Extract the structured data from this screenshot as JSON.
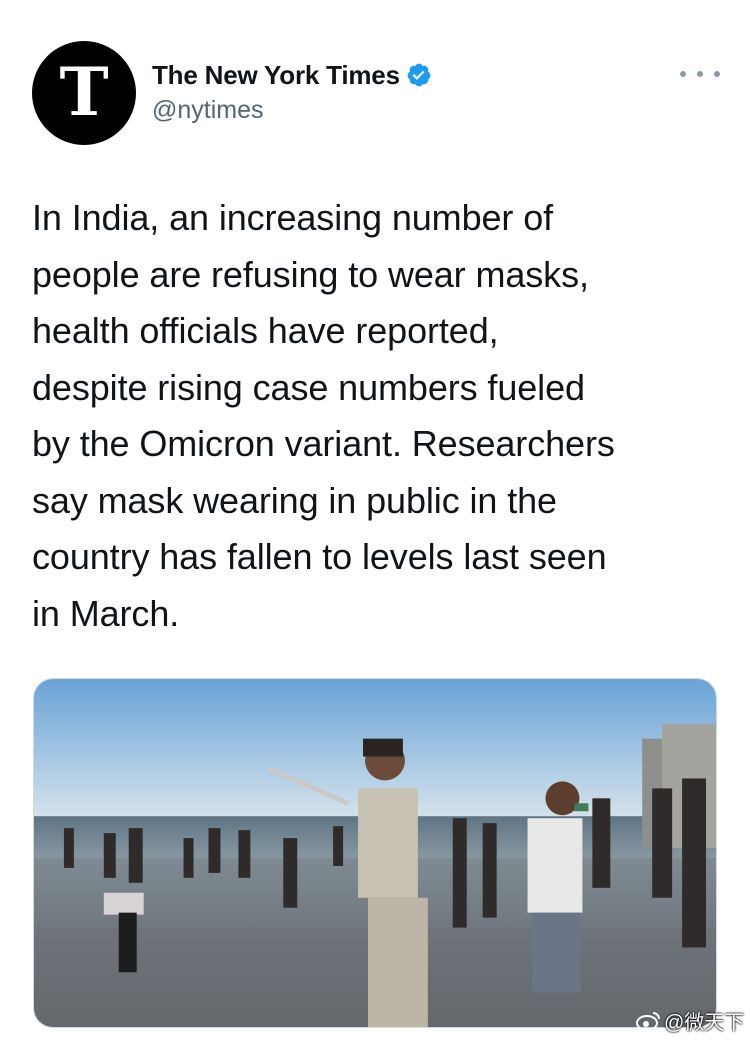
{
  "author": {
    "display_name": "The New York Times",
    "handle": "@nytimes",
    "avatar_icon": "nyt-t-logo",
    "verified_icon": "verified-badge-icon",
    "verified_color": "#1d9bf0"
  },
  "header": {
    "more_icon": "more-options-icon"
  },
  "tweet": {
    "text": "In India, an increasing number of\npeople are refusing to wear masks,\nhealth officials have reported,\ndespite rising case numbers fueled\nby the Omicron variant. Researchers\nsay mask wearing in public in the\ncountry has fallen to levels last seen\nin March."
  },
  "media": {
    "description": "photo",
    "icon": "beach-photo"
  },
  "watermark": {
    "text": "@微天下",
    "icon": "weibo-logo-icon"
  }
}
